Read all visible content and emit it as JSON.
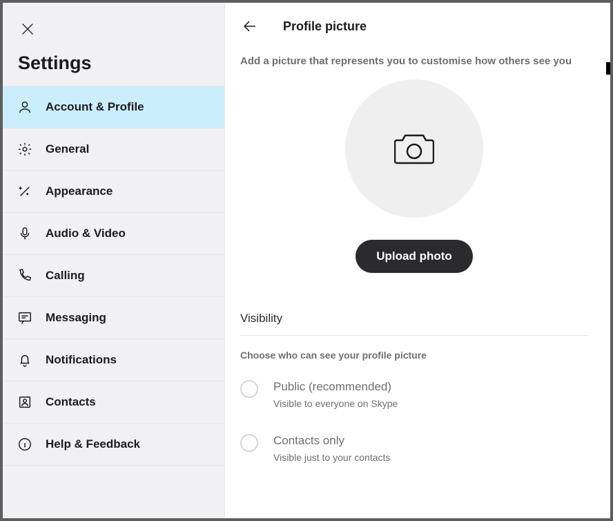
{
  "sidebar": {
    "title": "Settings",
    "items": [
      {
        "id": "account-profile",
        "label": "Account & Profile",
        "active": true
      },
      {
        "id": "general",
        "label": "General"
      },
      {
        "id": "appearance",
        "label": "Appearance"
      },
      {
        "id": "audio-video",
        "label": "Audio & Video"
      },
      {
        "id": "calling",
        "label": "Calling"
      },
      {
        "id": "messaging",
        "label": "Messaging"
      },
      {
        "id": "notifications",
        "label": "Notifications"
      },
      {
        "id": "contacts",
        "label": "Contacts"
      },
      {
        "id": "help-feedback",
        "label": "Help & Feedback"
      }
    ]
  },
  "main": {
    "title": "Profile picture",
    "description": "Add a picture that represents you to customise how others see you",
    "upload_label": "Upload photo",
    "visibility": {
      "heading": "Visibility",
      "help": "Choose who can see your profile picture",
      "options": [
        {
          "id": "public",
          "label": "Public (recommended)",
          "sub": "Visible to everyone on Skype"
        },
        {
          "id": "contacts",
          "label": "Contacts only",
          "sub": "Visible just to your contacts"
        }
      ]
    }
  }
}
